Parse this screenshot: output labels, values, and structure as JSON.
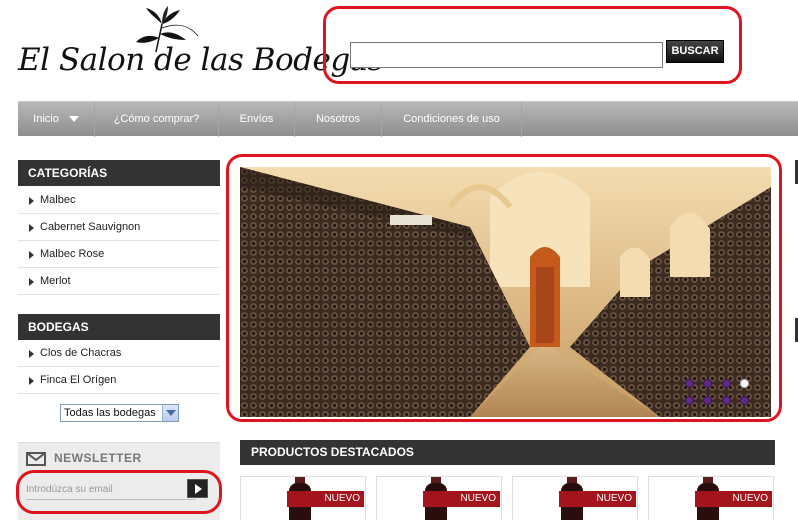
{
  "logo": {
    "text": "El Salon de las Bodegas"
  },
  "search": {
    "placeholder": "",
    "value": "",
    "button_label": "BUSCAR"
  },
  "nav": {
    "items": [
      {
        "label": "Inicio"
      },
      {
        "label": "¿Cómo comprar?"
      },
      {
        "label": "Envíos"
      },
      {
        "label": "Nosotros"
      },
      {
        "label": "Condiciones de uso"
      }
    ]
  },
  "categories": {
    "title": "CATEGORÍAS",
    "items": [
      {
        "label": "Malbec"
      },
      {
        "label": "Cabernet Sauvignon"
      },
      {
        "label": "Malbec Rose"
      },
      {
        "label": "Merlot"
      }
    ]
  },
  "bodegas": {
    "title": "BODEGAS",
    "items": [
      {
        "label": "Clos de Chacras"
      },
      {
        "label": "Finca El Orígen"
      }
    ],
    "select_value": "Todas las bodegas"
  },
  "newsletter": {
    "title": "NEWSLETTER",
    "placeholder": "Introdúzca su email",
    "icon": "envelope-icon"
  },
  "slider": {
    "dot_count": 8,
    "active_index": 3
  },
  "featured": {
    "title": "PRODUCTOS DESTACADOS",
    "products": [
      {
        "badge": "NUEVO"
      },
      {
        "badge": "NUEVO"
      },
      {
        "badge": "NUEVO"
      },
      {
        "badge": "NUEVO"
      }
    ]
  },
  "colors": {
    "accent_dark": "#333333",
    "nav_gray": "#a0a0a0",
    "badge_red": "#a4141d",
    "annotation_red": "#e0141e",
    "slider_dot": "#5c2b86"
  }
}
